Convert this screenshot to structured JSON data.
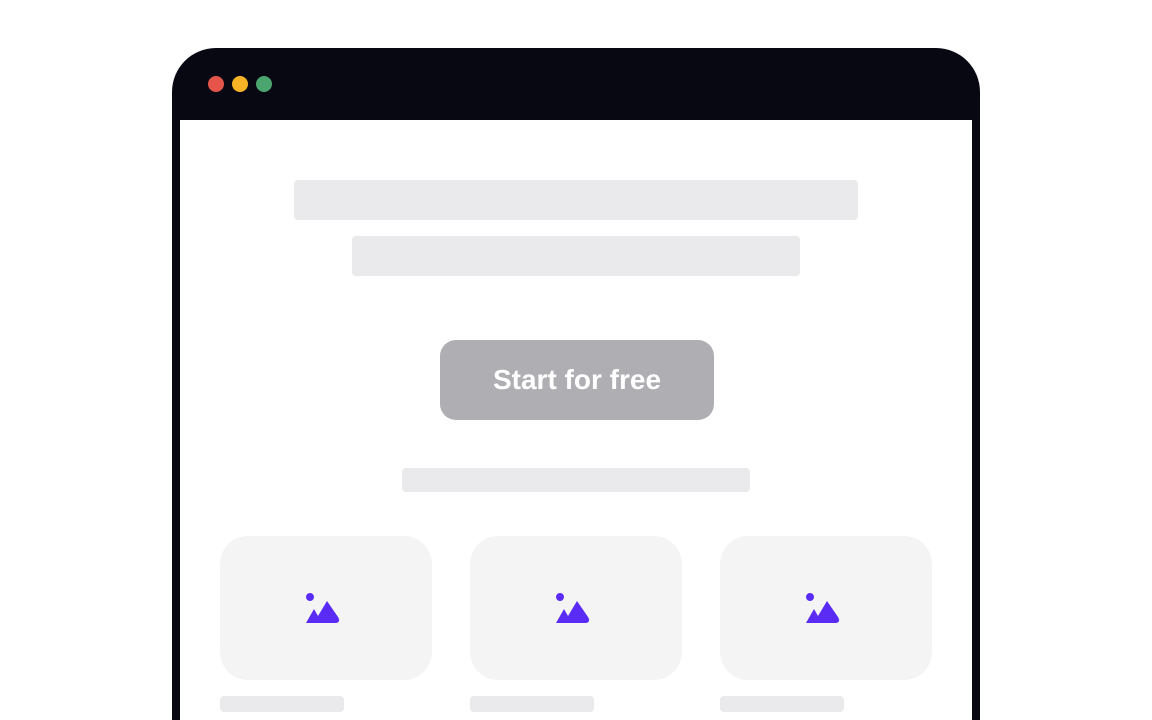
{
  "window": {
    "controls": [
      {
        "name": "close",
        "color": "#e5544b"
      },
      {
        "name": "minimize",
        "color": "#f5b325"
      },
      {
        "name": "maximize",
        "color": "#4aa56f"
      }
    ],
    "frame_color": "#080812"
  },
  "hero": {
    "cta_label": "Start for free",
    "cta_color": "#afafb3"
  },
  "cards": [
    {
      "icon": "image-icon"
    },
    {
      "icon": "image-icon"
    },
    {
      "icon": "image-icon"
    }
  ],
  "colors": {
    "placeholder": "#eaeaec",
    "card_background": "#f4f4f5",
    "accent": "#5a2bf5"
  }
}
